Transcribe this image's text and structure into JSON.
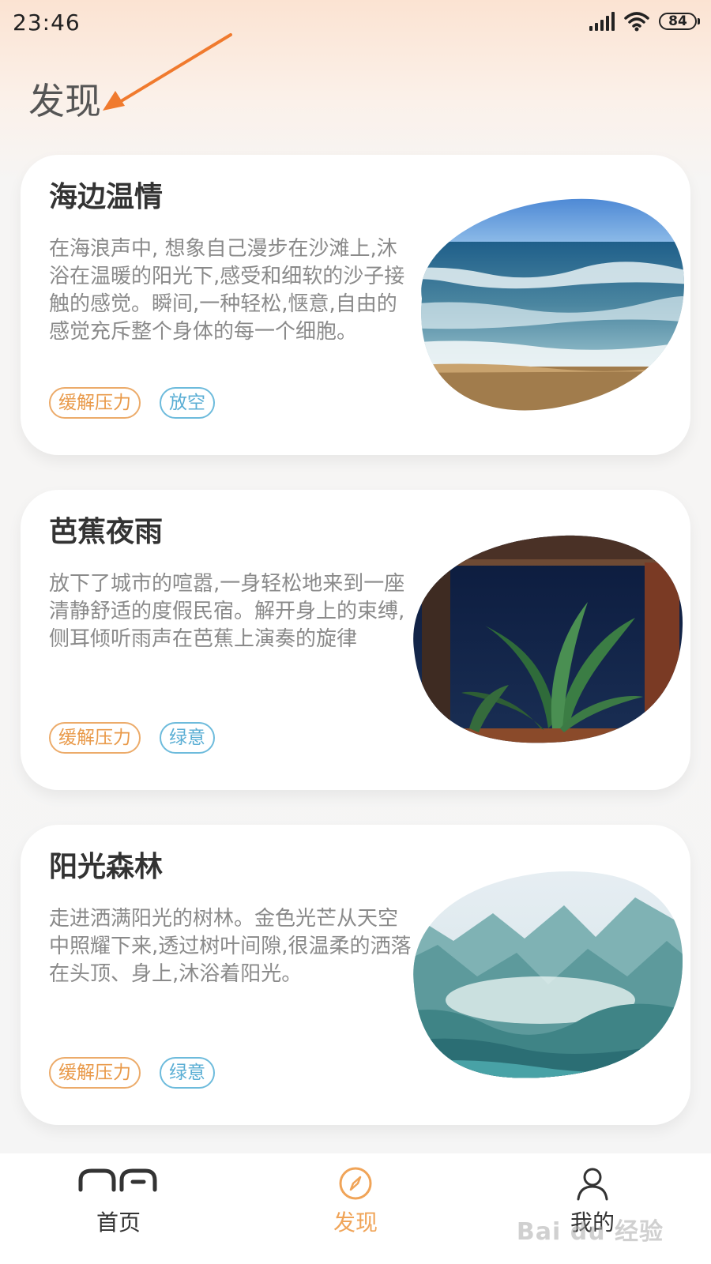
{
  "status_bar": {
    "time": "23:46",
    "battery": "84"
  },
  "page": {
    "title": "发现"
  },
  "cards": [
    {
      "title": "海边温情",
      "description": "在海浪声中, 想象自己漫步在沙滩上,沐浴在温暖的阳光下,感受和细软的沙子接触的感觉。瞬间,一种轻松,惬意,自由的感觉充斥整个身体的每一个细胞。",
      "tags": [
        "缓解压力",
        "放空"
      ]
    },
    {
      "title": "芭蕉夜雨",
      "description": "放下了城市的喧嚣,一身轻松地来到一座清静舒适的度假民宿。解开身上的束缚,侧耳倾听雨声在芭蕉上演奏的旋律",
      "tags": [
        "缓解压力",
        "绿意"
      ]
    },
    {
      "title": "阳光森林",
      "description": "走进洒满阳光的树林。金色光芒从天空中照耀下来,透过树叶间隙,很温柔的洒落在头顶、身上,沐浴着阳光。",
      "tags": [
        "缓解压力",
        "绿意"
      ]
    }
  ],
  "bottom_nav": [
    {
      "label": "首页",
      "icon": "home-icon"
    },
    {
      "label": "发现",
      "icon": "compass-icon",
      "active": true
    },
    {
      "label": "我的",
      "icon": "person-icon"
    }
  ],
  "watermark": "Bai du 经验",
  "colors": {
    "accent": "#f0a458",
    "tag_orange": "#e99a4a",
    "tag_blue": "#5aaed4"
  }
}
